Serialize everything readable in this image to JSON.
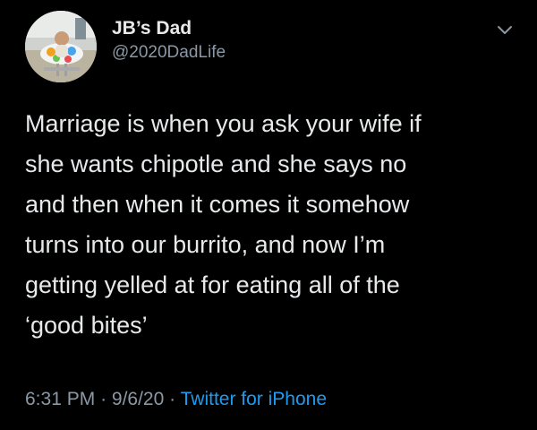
{
  "user": {
    "display_name": "JB’s Dad",
    "handle": "@2020DadLife",
    "avatar_icon": "baby-in-walker-avatar"
  },
  "menu": {
    "icon": "chevron-down-icon"
  },
  "tweet": {
    "text": "Marriage is when you ask your wife if\nshe wants chipotle and she says no\nand then when it comes it somehow\nturns into our burrito, and now I’m\ngetting yelled at for eating all of the\n‘good bites’"
  },
  "meta": {
    "time": "6:31 PM",
    "date": "9/6/20",
    "separator": "·",
    "source": "Twitter for iPhone"
  },
  "colors": {
    "background": "#000000",
    "text": "#e7e9ea",
    "muted": "#8b98a5",
    "link": "#1d9bf0"
  }
}
